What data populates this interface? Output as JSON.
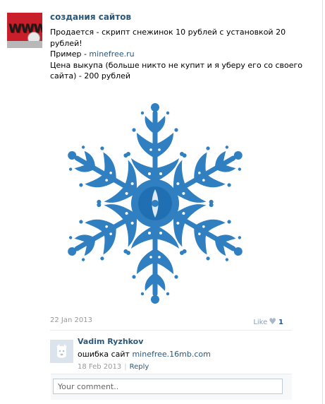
{
  "post": {
    "author": "создания сайтов",
    "text_line1": "Продается - скрипт снежинок 10 рублей с установкой 20",
    "text_line2": "рублей!",
    "text_line3_prefix": "Пример - ",
    "text_line3_link": "minefree.ru",
    "text_line4": "Цена выкупа (больше никто не купит и я уберу его со своего",
    "text_line5": "сайта) - 200 рублей",
    "avatar_text": "WWW",
    "date": "22 Jan 2013",
    "like_label": "Like",
    "like_count": "1",
    "image_color": "#2f7fc1"
  },
  "comment": {
    "author": "Vadim Ryzhkov",
    "text_prefix": "ошибка сайт ",
    "text_link": "minefree.16mb.com",
    "date": "18 Feb 2013",
    "reply_label": "Reply"
  },
  "reply_box": {
    "placeholder": "Your comment.."
  },
  "colors": {
    "link": "#2b587a",
    "muted": "#999999",
    "snowflake": "#2f7fc1"
  }
}
